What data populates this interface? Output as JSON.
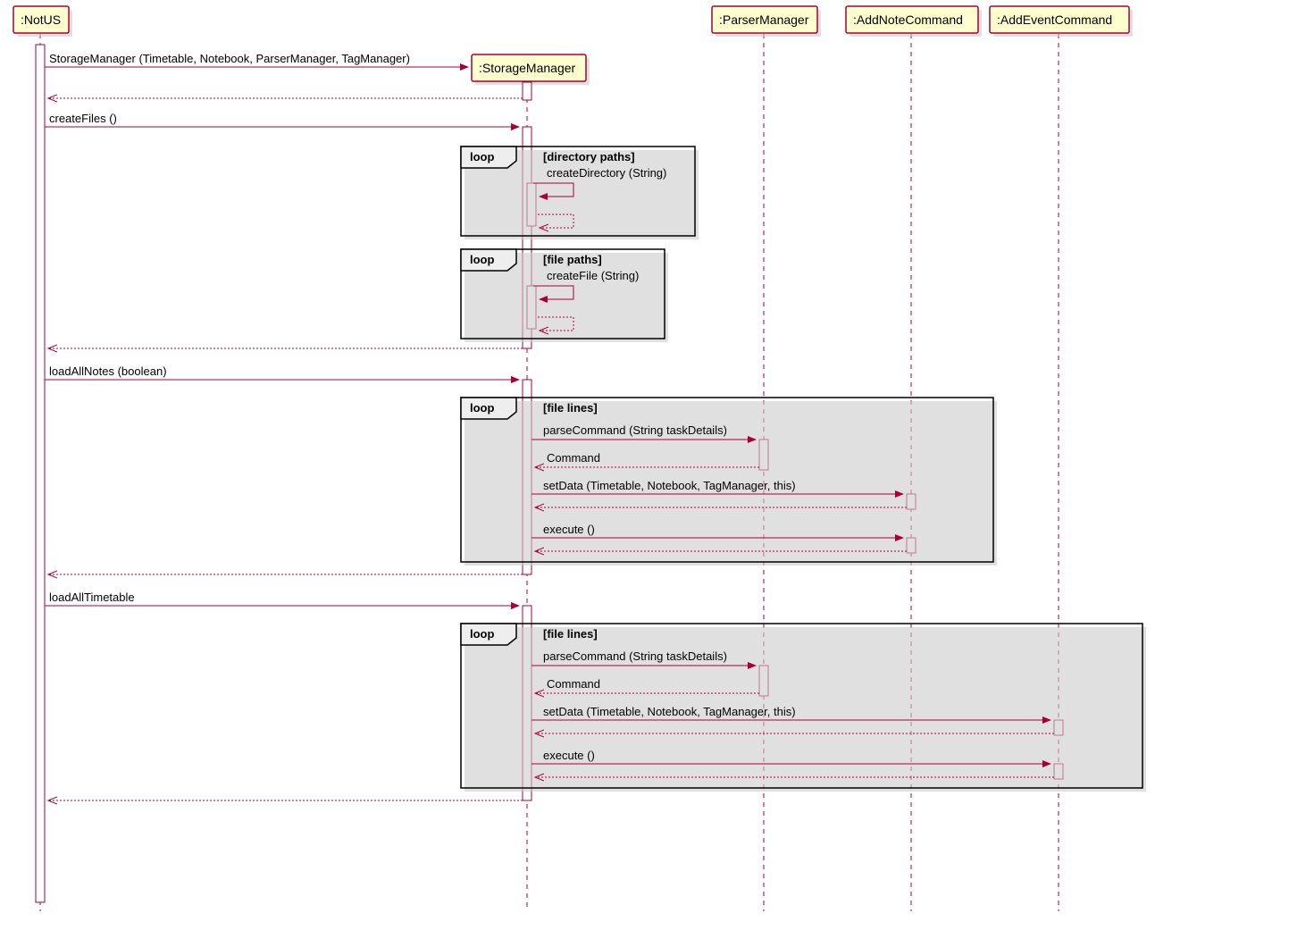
{
  "participants": {
    "p0": ":NotUS",
    "p1": ":StorageManager",
    "p2": ":ParserManager",
    "p3": ":AddNoteCommand",
    "p4": ":AddEventCommand"
  },
  "messages": {
    "m_create": "StorageManager (Timetable, Notebook, ParserManager, TagManager)",
    "m_createFiles": "createFiles ()",
    "m_createDirectory": "createDirectory (String)",
    "m_createFile": "createFile (String)",
    "m_loadAllNotes": "loadAllNotes (boolean)",
    "m_parseCommand": "parseCommand (String taskDetails)",
    "m_Command": "Command",
    "m_setData": "setData (Timetable, Notebook, TagManager, this)",
    "m_execute": "execute ()",
    "m_loadAllTimetable": "loadAllTimetable"
  },
  "fragments": {
    "loop": "loop",
    "g_dirpaths": "[directory paths]",
    "g_filepaths": "[file paths]",
    "g_filelines": "[file lines]"
  }
}
